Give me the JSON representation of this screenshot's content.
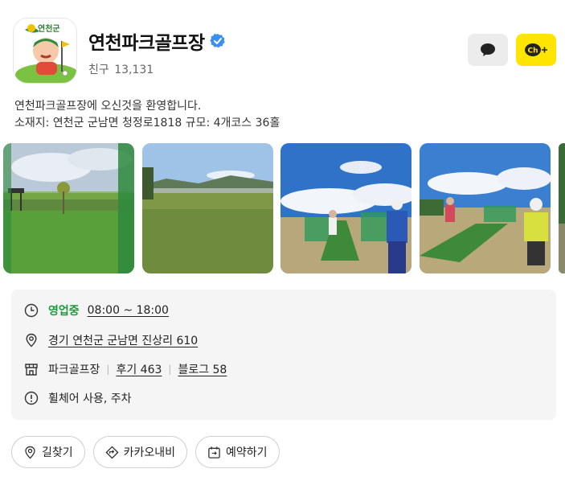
{
  "profile": {
    "logo_text": "연천군",
    "name": "연천파크골프장",
    "friends_label": "친구",
    "friends_count": "13,131"
  },
  "intro": {
    "line1": "연천파크골프장에 오신것을 환영합니다.",
    "line2": "소재지: 연천군 군남면 청정로1818 규모: 4개코스 36홀"
  },
  "photos": [
    {
      "alt": "golf course with green nets"
    },
    {
      "alt": "riverside fairway"
    },
    {
      "alt": "golfer on practice mat"
    },
    {
      "alt": "golfers practicing"
    }
  ],
  "info": {
    "status": "영업중",
    "hours": "08:00 ~ 18:00",
    "address": "경기 연천군 군남면 진상리 610",
    "category": "파크골프장",
    "reviews": "후기 463",
    "blogs": "블로그 58",
    "amenities": "휠체어 사용, 주차"
  },
  "actions": {
    "directions": "길찾기",
    "kakaonavi": "카카오내비",
    "reserve": "예약하기"
  },
  "colors": {
    "open_status": "#1a9a3c",
    "channel_button": "#fee500",
    "chat_button": "#ececec"
  }
}
